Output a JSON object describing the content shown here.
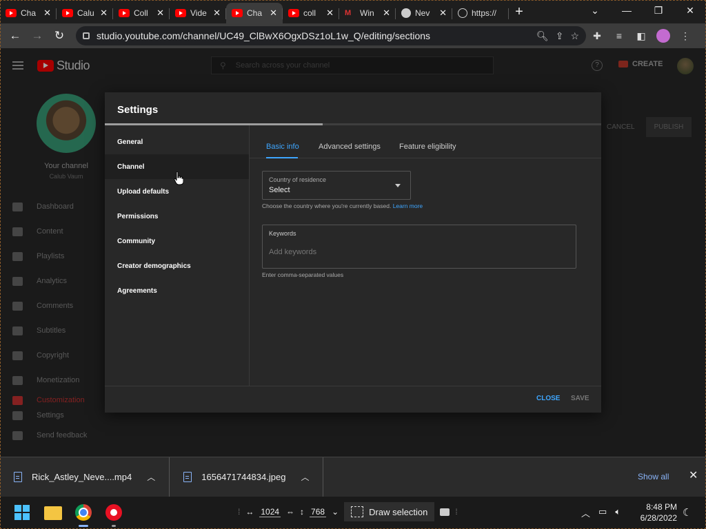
{
  "browser": {
    "tabs": [
      {
        "title": "Cha",
        "favicon": "youtube-icon",
        "active": false
      },
      {
        "title": "Calu",
        "favicon": "youtube-icon",
        "active": false
      },
      {
        "title": "Coll",
        "favicon": "youtube-icon",
        "active": false
      },
      {
        "title": "Vide",
        "favicon": "youtube-icon",
        "active": false
      },
      {
        "title": "Cha",
        "favicon": "youtube-icon",
        "active": true
      },
      {
        "title": "coll",
        "favicon": "youtube-icon",
        "active": false
      },
      {
        "title": "Win",
        "favicon": "m-logo-icon",
        "active": false
      },
      {
        "title": "Nev",
        "favicon": "chrome-icon",
        "active": false
      },
      {
        "title": "https://",
        "favicon": "globe-icon",
        "active": false
      }
    ],
    "url": "studio.youtube.com/channel/UC49_ClBwX6OgxDSz1oL1w_Q/editing/sections"
  },
  "studio": {
    "logo_text": "Studio",
    "search_placeholder": "Search across your channel",
    "create_label": "CREATE",
    "channel_caption": "Your channel",
    "channel_name": "Calub Vaum",
    "nav": [
      "Dashboard",
      "Content",
      "Playlists",
      "Analytics",
      "Comments",
      "Subtitles",
      "Copyright",
      "Monetization",
      "Customization",
      "Settings",
      "Send feedback"
    ],
    "cancel_label": "CANCEL",
    "publish_label": "PUBLISH"
  },
  "dialog": {
    "title": "Settings",
    "nav": [
      "General",
      "Channel",
      "Upload defaults",
      "Permissions",
      "Community",
      "Creator demographics",
      "Agreements"
    ],
    "tabs": [
      "Basic info",
      "Advanced settings",
      "Feature eligibility"
    ],
    "country_label": "Country of residence",
    "country_value": "Select",
    "country_help": "Choose the country where you're currently based.",
    "learn_more": "Learn more",
    "keywords_label": "Keywords",
    "keywords_placeholder": "Add keywords",
    "keywords_help": "Enter comma-separated values",
    "close_label": "CLOSE",
    "save_label": "SAVE"
  },
  "downloads": {
    "items": [
      "Rick_Astley_Neve....mp4",
      "1656471744834.jpeg"
    ],
    "show_all": "Show all"
  },
  "taskbar": {
    "width_value": "1024",
    "height_value": "768",
    "draw_selection": "Draw selection",
    "time": "8:48 PM",
    "date": "6/28/2022"
  },
  "colors": {
    "accent": "#3ea6ff",
    "youtube_red": "#ff0000"
  }
}
